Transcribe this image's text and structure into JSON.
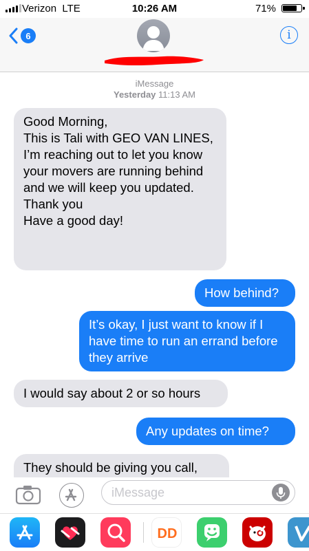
{
  "status_bar": {
    "carrier": "Verizon",
    "network": "LTE",
    "time": "10:26 AM",
    "battery_percent": "71%",
    "battery_level": 0.71
  },
  "header": {
    "back_badge_count": "6",
    "contact_name_redacted": true,
    "info_icon": "info-icon",
    "accent_color": "#1a7ef7"
  },
  "conversation": {
    "service": "iMessage",
    "timestamp_day": "Yesterday",
    "timestamp_time": "11:13 AM",
    "messages": [
      {
        "direction": "incoming",
        "text": "Good Morning,\nThis is Tali with GEO VAN LINES,\nI’m reaching out to let you know your movers are running behind and we will keep you updated.\nThank you\nHave a good day!"
      },
      {
        "direction": "outgoing",
        "text": "How behind?"
      },
      {
        "direction": "outgoing",
        "text": "It’s okay, I just want to know if I have time to run an errand before they arrive"
      },
      {
        "direction": "incoming",
        "text": "I would say about 2 or so hours"
      },
      {
        "direction": "outgoing",
        "text": "Any updates on time?"
      },
      {
        "direction": "incoming",
        "text": "They should be giving you call,"
      }
    ]
  },
  "compose": {
    "placeholder": "iMessage",
    "value": "",
    "icons": [
      "camera-icon",
      "app-store-icon",
      "microphone-icon"
    ]
  },
  "app_drawer": {
    "apps": [
      "app-store-app",
      "digital-touch-app",
      "images-search-app",
      "dunkin-app",
      "bitmoji-app",
      "target-app",
      "venmo-app"
    ]
  },
  "colors": {
    "outgoing_bubble": "#1a7ef7",
    "incoming_bubble": "#e5e5ea",
    "redaction": "#ff0000"
  }
}
